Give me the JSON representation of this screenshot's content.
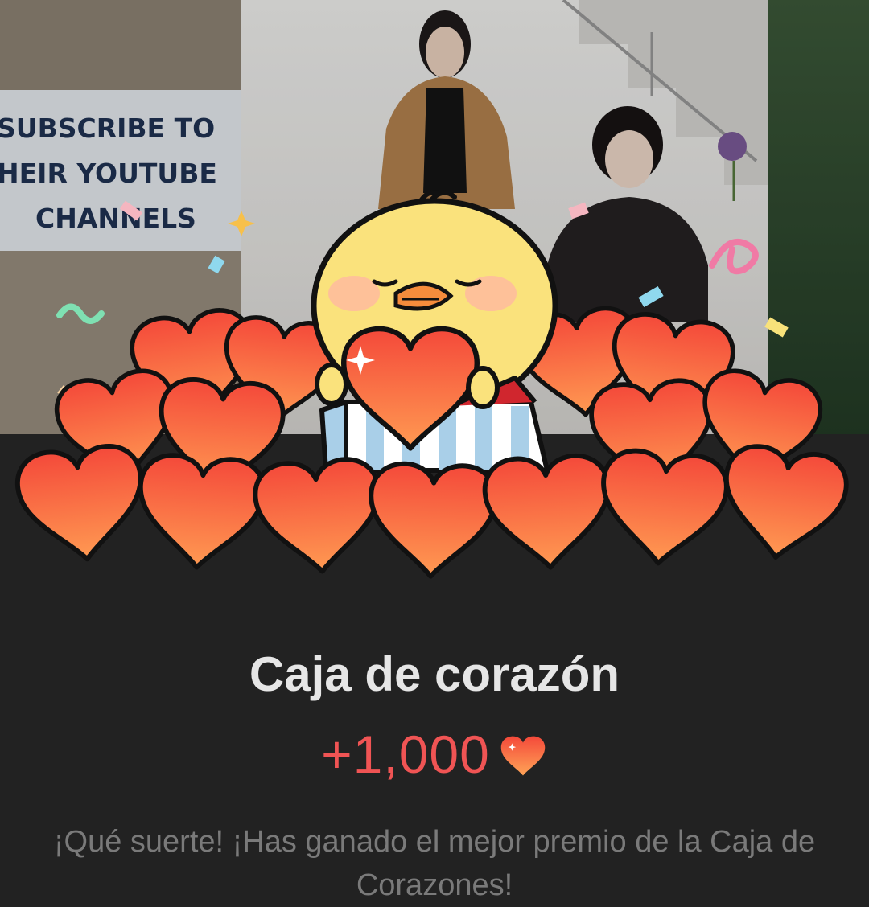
{
  "promo": {
    "line1": "SUBSCRIBE TO",
    "line2": "HEIR YOUTUBE",
    "line3": "CHANNELS"
  },
  "reward": {
    "title": "Caja de corazón",
    "amount": "+1,000",
    "message": "¡Qué suerte! ¡Has ganado el mejor premio de la Caja de Corazones!"
  },
  "icons": {
    "currency": "heart-icon",
    "mascot": "chick-character",
    "gift": "gift-box-icon"
  },
  "colors": {
    "accent": "#f05454",
    "background": "#222222",
    "heart_fill": "#f46b45",
    "title_text": "#e6e6e6",
    "message_text": "#7a7a7a"
  }
}
